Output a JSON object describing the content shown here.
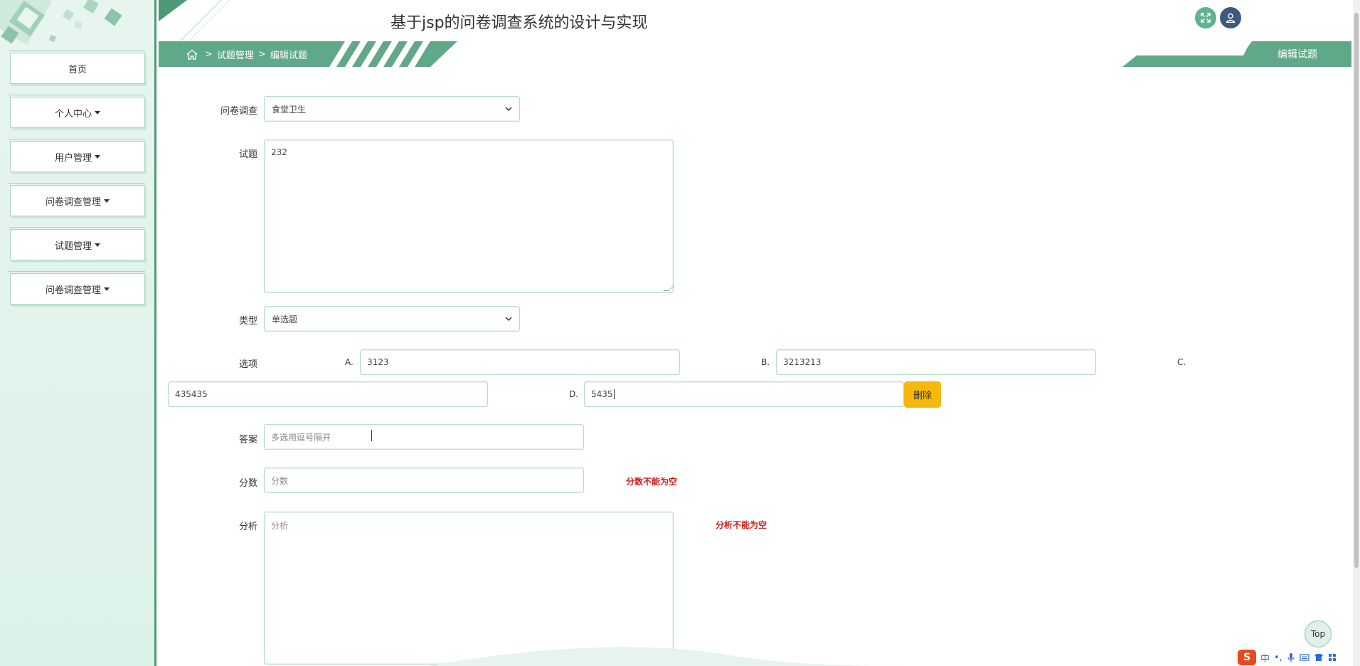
{
  "app_title": "基于jsp的问卷调查系统的设计与实现",
  "sidebar": {
    "items": [
      {
        "label": "首页",
        "dropdown": false
      },
      {
        "label": "个人中心",
        "dropdown": true
      },
      {
        "label": "用户管理",
        "dropdown": true
      },
      {
        "label": "问卷调查管理",
        "dropdown": true
      },
      {
        "label": "试题管理",
        "dropdown": true
      },
      {
        "label": "问卷调查管理",
        "dropdown": true
      }
    ]
  },
  "breadcrumb": {
    "sep1": ">",
    "level1": "试题管理",
    "sep2": ">",
    "level2": "编辑试题"
  },
  "page_label": "编辑试题",
  "form": {
    "survey": {
      "label": "问卷调查",
      "value": "食堂卫生"
    },
    "question": {
      "label": "试题",
      "value": "232"
    },
    "type": {
      "label": "类型",
      "value": "单选题"
    },
    "options": {
      "label": "选项",
      "items": [
        {
          "letter": "A.",
          "value": "3123"
        },
        {
          "letter": "B.",
          "value": "3213213"
        },
        {
          "letter": "C.",
          "value": "435435"
        },
        {
          "letter": "D.",
          "value": "5435"
        }
      ],
      "delete_label": "删除"
    },
    "answer": {
      "label": "答案",
      "placeholder": "多选用逗号隔开"
    },
    "score": {
      "label": "分数",
      "placeholder": "分数",
      "error": "分数不能为空"
    },
    "analysis": {
      "label": "分析",
      "placeholder": "分析",
      "error": "分析不能为空"
    }
  },
  "top_button": "Top",
  "ime": {
    "logo": "S",
    "lang": "中",
    "punct": "•,"
  },
  "colors": {
    "primary_green": "#5fb38e",
    "sidebar_bg": "#e7f5ef",
    "delete_yellow": "#f5b80b",
    "error_red": "#d21c1c",
    "user_blue": "#3d5a7e"
  }
}
